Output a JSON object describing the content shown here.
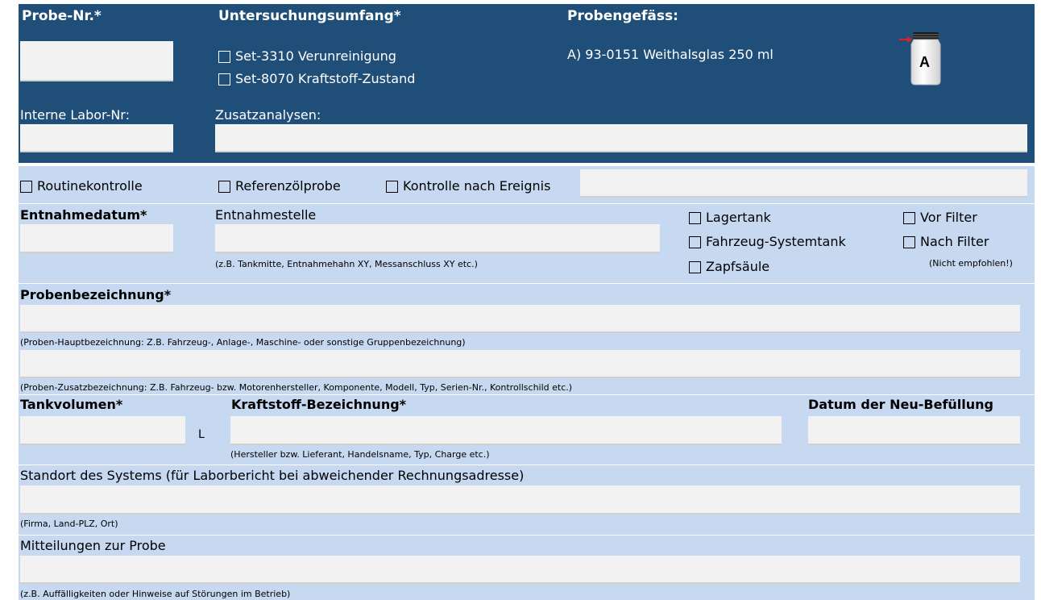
{
  "header": {
    "probe_nr_label": "Probe-Nr.*",
    "untersuchung_label": "Untersuchungsumfang*",
    "probengefaess_label": "Probengefäss:",
    "set1_label": "Set-3310 Verunreinigung",
    "set2_label": "Set-8070 Kraftstoff-Zustand",
    "container_text": "A) 93-0151 Weithalsglas 250 ml",
    "jar_letter": "A",
    "interne_label": "Interne Labor-Nr:",
    "zusatz_label": "Zusatzanalysen:"
  },
  "control": {
    "routine": "Routinekontrolle",
    "referenz": "Referenzölprobe",
    "ereignis": "Kontrolle nach Ereignis"
  },
  "sampling": {
    "datum_label": "Entnahmedatum*",
    "stelle_label": "Entnahmestelle",
    "stelle_hint": "(z.B. Tankmitte, Entnahmehahn XY, Messanschluss XY etc.)",
    "lagertank": "Lagertank",
    "systemtank": "Fahrzeug-Systemtank",
    "zapfsaeule": "Zapfsäule",
    "vor_filter": "Vor Filter",
    "nach_filter": "Nach Filter",
    "nicht_empfohlen": "(Nicht empfohlen!)"
  },
  "bezeichnung": {
    "label": "Probenbezeichnung*",
    "hint_main": "(Proben-Hauptbezeichnung: Z.B. Fahrzeug-, Anlage-, Maschine- oder sonstige Gruppenbezeichnung)",
    "hint_sub": "(Proben-Zusatzbezeichnung: Z.B. Fahrzeug- bzw. Motorenhersteller, Komponente, Modell, Typ, Serien-Nr., Kontrollschild etc.)"
  },
  "tank": {
    "volumen_label": "Tankvolumen*",
    "unit": "L",
    "kraftstoff_label": "Kraftstoff-Bezeichnung*",
    "kraftstoff_hint": "(Hersteller bzw. Lieferant, Handelsname, Typ, Charge etc.)",
    "neu_label": "Datum der Neu-Befüllung"
  },
  "standort": {
    "label": "Standort des Systems (für Laborbericht bei abweichender Rechnungsadresse)",
    "hint": "(Firma, Land-PLZ, Ort)"
  },
  "mitteilungen": {
    "label": "Mitteilungen zur Probe",
    "hint": "(z.B. Auffälligkeiten oder Hinweise auf Störungen im Betrieb)"
  },
  "colors": {
    "header_bg": "#1f4e79",
    "section_bg": "#c6d9f1",
    "field_bg": "#f2f2f2",
    "jar_arrow": "#e02020"
  }
}
